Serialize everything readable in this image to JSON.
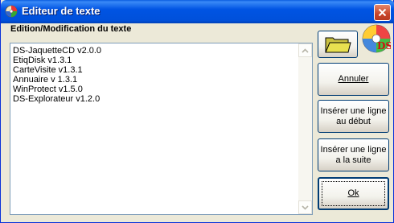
{
  "window": {
    "title": "Editeur de texte"
  },
  "section": {
    "title": "Edition/Modification du texte"
  },
  "editor": {
    "lines": [
      "DS-JaquetteCD v2.0.0",
      "EtiqDisk v1.3.1",
      "CarteVisite v1.3.1",
      "Annuaire v 1.3.1",
      "WinProtect v1.5.0",
      "DS-Explorateur v1.2.0"
    ]
  },
  "buttons": {
    "annuler": "Annuler",
    "inserer_debut_line1": "Insérer une ligne",
    "inserer_debut_line2": "au début",
    "inserer_suite_line1": "Insérer une ligne",
    "inserer_suite_line2": "a la suite",
    "ok": "Ok"
  },
  "icons": {
    "app": "app-cd-icon",
    "close": "close-icon",
    "folder": "folder-open-icon",
    "logo": "ds-cd-logo-icon",
    "scroll_up": "arrow-up-icon",
    "scroll_down": "arrow-down-icon"
  },
  "colors": {
    "title_bar": "#0054e3",
    "close_button": "#c8452a",
    "folder": "#e8e050",
    "window_bg": "#ece9d8"
  }
}
